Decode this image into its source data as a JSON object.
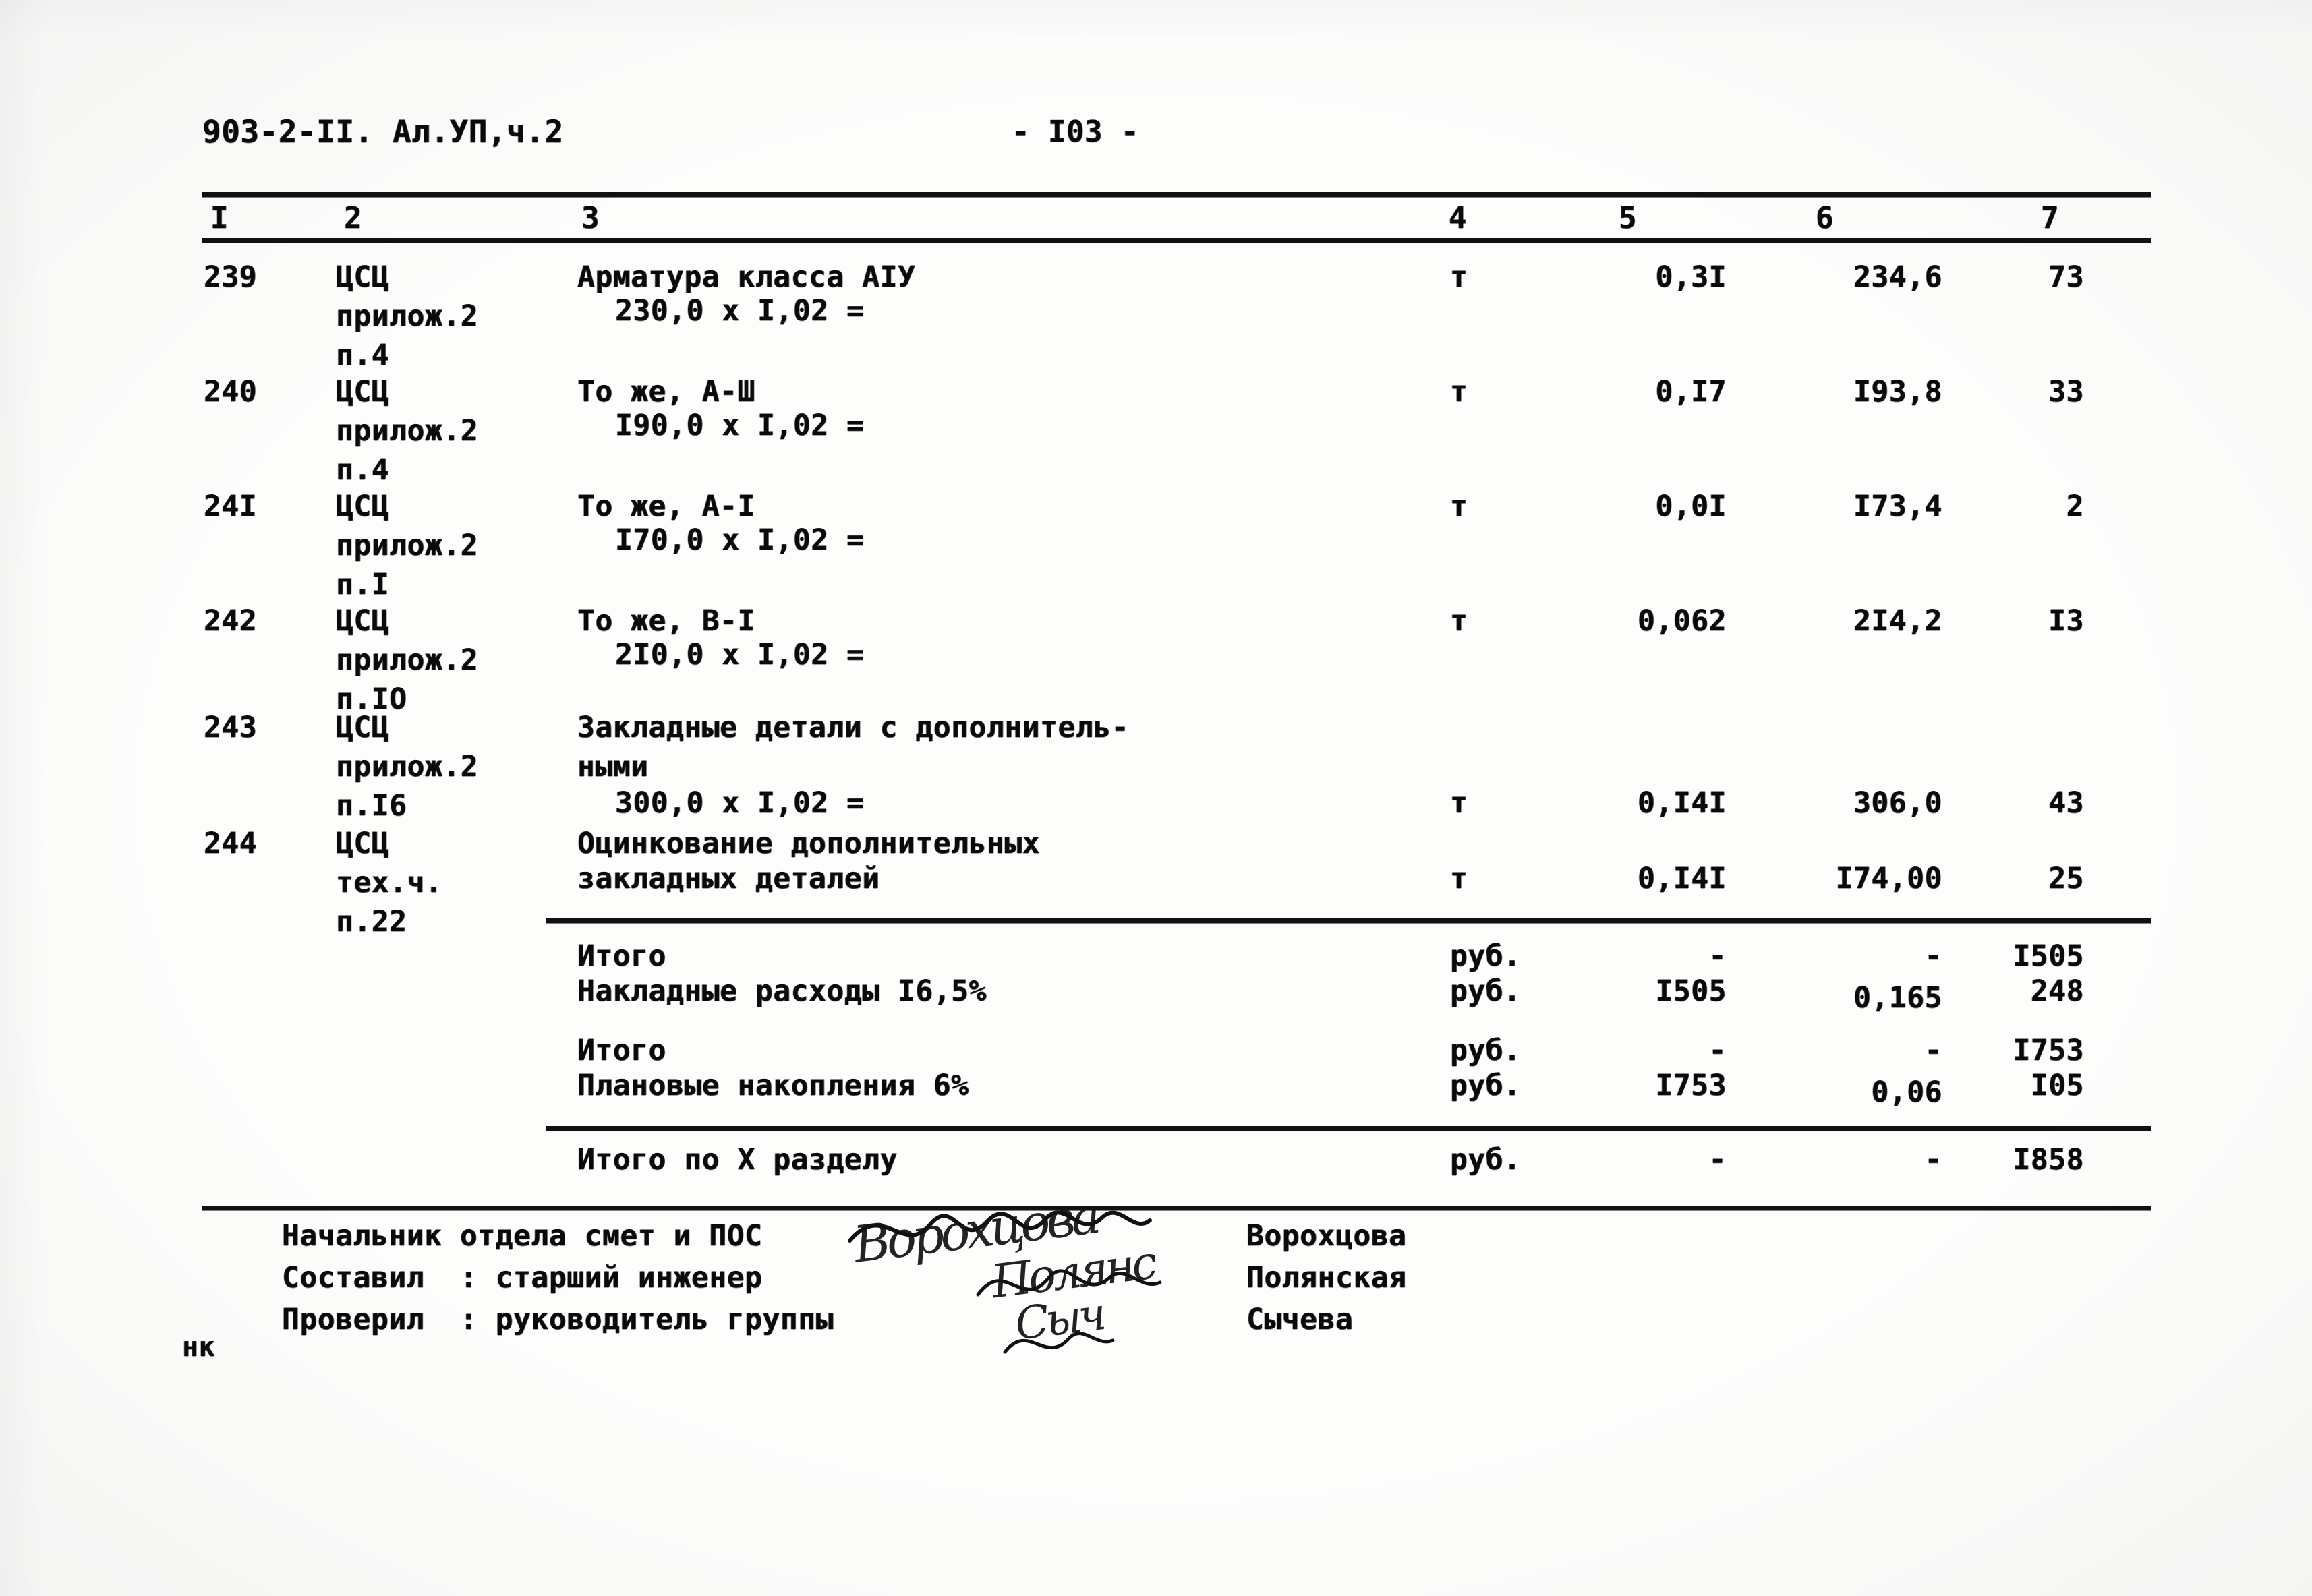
{
  "header": {
    "doc_code": "903-2-II. Ал.УП,ч.2",
    "page_number": "- I03 -"
  },
  "table": {
    "column_headers": [
      "I",
      "2",
      "3",
      "4",
      "5",
      "6",
      "7"
    ],
    "rows": [
      {
        "no": "239",
        "code_line1": "ЦСЦ",
        "code_line2": "прилож.2",
        "code_line3": "п.4",
        "desc_line1": "Арматура класса АIУ",
        "desc_line2": "230,0 х I,02 =",
        "unit": "т",
        "col5": "0,3I",
        "col6": "234,6",
        "col7": "73"
      },
      {
        "no": "240",
        "code_line1": "ЦСЦ",
        "code_line2": "прилож.2",
        "code_line3": "п.4",
        "desc_line1": "То же, А-Ш",
        "desc_line2": "I90,0 х I,02 =",
        "unit": "т",
        "col5": "0,I7",
        "col6": "I93,8",
        "col7": "33"
      },
      {
        "no": "24I",
        "code_line1": "ЦСЦ",
        "code_line2": "прилож.2",
        "code_line3": "п.I",
        "desc_line1": "То же, А-I",
        "desc_line2": "I70,0 х I,02 =",
        "unit": "т",
        "col5": "0,0I",
        "col6": "I73,4",
        "col7": "2"
      },
      {
        "no": "242",
        "code_line1": "ЦСЦ",
        "code_line2": "прилож.2",
        "code_line3": "п.IO",
        "desc_line1": "То же, В-I",
        "desc_line2": "2I0,0 х I,02 =",
        "unit": "т",
        "col5": "0,062",
        "col6": "2I4,2",
        "col7": "I3"
      },
      {
        "no": "243",
        "code_line1": "ЦСЦ",
        "code_line2": "прилож.2",
        "code_line3": "п.I6",
        "desc_line1": "Закладные детали с дополнитель-",
        "desc_line1b": "ными",
        "desc_line2": "300,0 х I,02 =",
        "unit": "т",
        "col5": "0,I4I",
        "col6": "306,0",
        "col7": "43"
      },
      {
        "no": "244",
        "code_line1": "ЦСЦ",
        "code_line2": "тех.ч.",
        "code_line3": "п.22",
        "desc_line1": "Оцинкование дополнительных",
        "desc_line2": "закладных деталей",
        "unit": "т",
        "col5": "0,I4I",
        "col6": "I74,00",
        "col7": "25"
      }
    ],
    "summary_group_1": [
      {
        "label": "Итого",
        "unit": "руб.",
        "col5": "-",
        "col6": "-",
        "col7": "I505"
      },
      {
        "label": "Накладные расходы I6,5%",
        "unit": "руб.",
        "col5": "I505",
        "col6": "0,165",
        "col7": "248"
      }
    ],
    "summary_group_2": [
      {
        "label": "Итого",
        "unit": "руб.",
        "col5": "-",
        "col6": "-",
        "col7": "I753"
      },
      {
        "label": "Плановые накопления 6%",
        "unit": "руб.",
        "col5": "I753",
        "col6": "0,06",
        "col7": "I05"
      }
    ],
    "grand_total": {
      "label": "Итого по Х разделу",
      "unit": "руб.",
      "col5": "-",
      "col6": "-",
      "col7": "I858"
    }
  },
  "signatures": {
    "rows": [
      {
        "label": "Начальник отдела смет и ПОС",
        "name": "Ворохцова",
        "handwriting": "Ворохцова"
      },
      {
        "label": "Составил  : старший инженер",
        "name": "Полянская",
        "handwriting": "Полянс"
      },
      {
        "label": "Проверил  : руководитель группы",
        "name": "Сычева",
        "handwriting": "Сыч"
      }
    ]
  },
  "footer": {
    "mark": "нк"
  }
}
